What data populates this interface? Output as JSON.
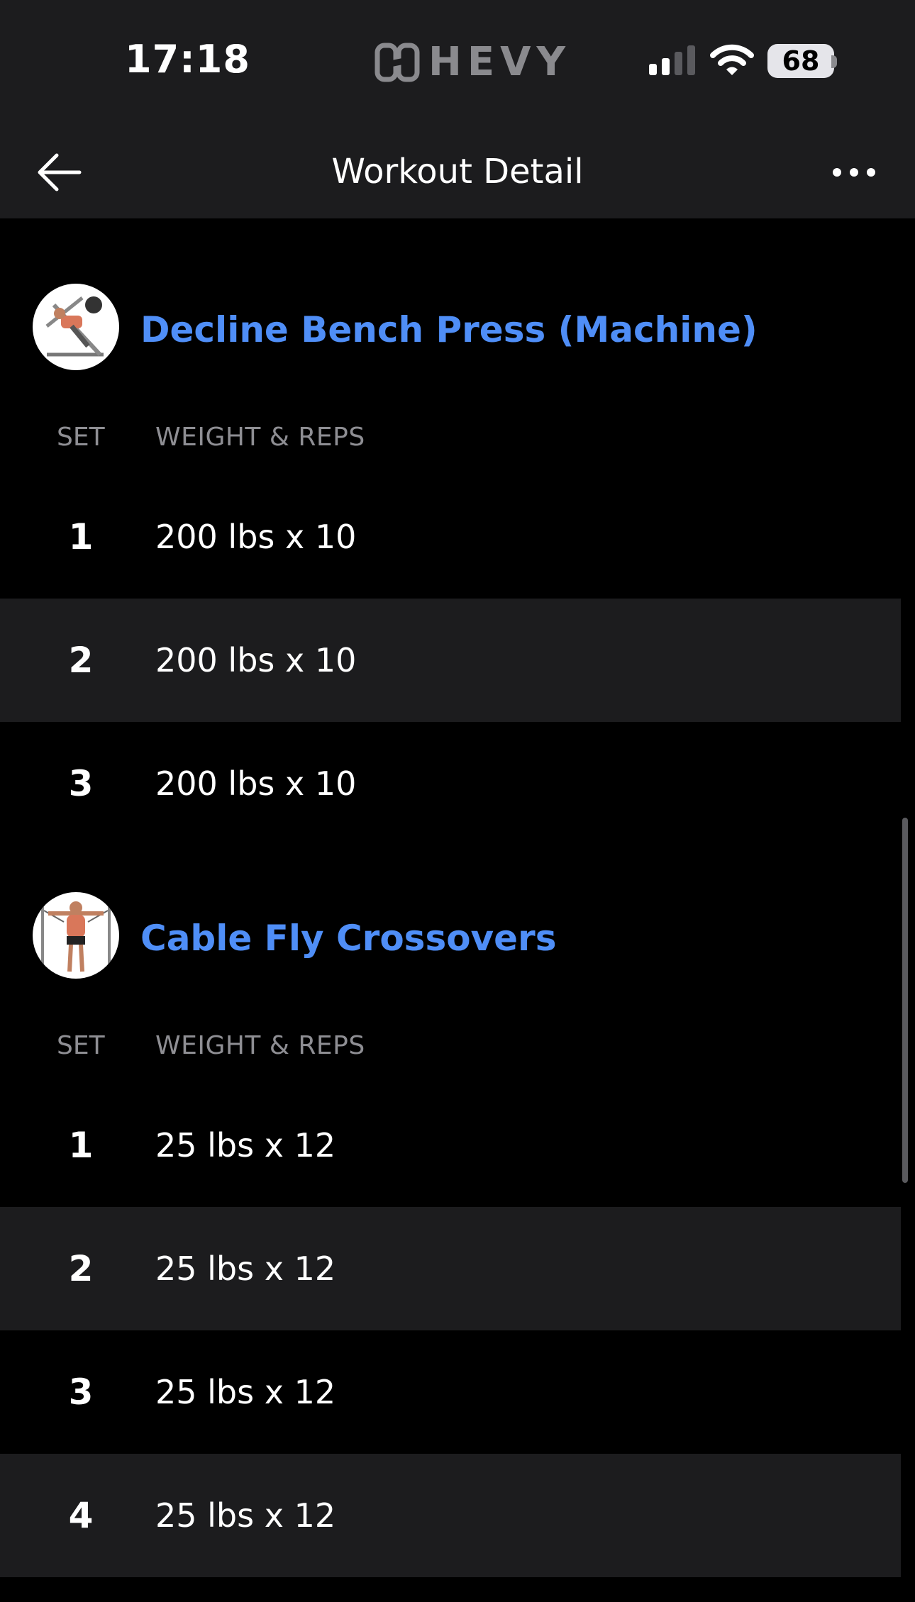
{
  "status_bar": {
    "time": "17:18",
    "brand": "HEVY",
    "battery": "68"
  },
  "nav": {
    "title": "Workout Detail"
  },
  "exercises": [
    {
      "name": "Decline Bench Press (Machine)",
      "col_set": "SET",
      "col_weight_reps": "WEIGHT & REPS",
      "sets": [
        {
          "num": "1",
          "value": "200 lbs x 10"
        },
        {
          "num": "2",
          "value": "200 lbs x 10"
        },
        {
          "num": "3",
          "value": "200 lbs x 10"
        }
      ]
    },
    {
      "name": "Cable Fly Crossovers",
      "col_set": "SET",
      "col_weight_reps": "WEIGHT & REPS",
      "sets": [
        {
          "num": "1",
          "value": "25 lbs x 12"
        },
        {
          "num": "2",
          "value": "25 lbs x 12"
        },
        {
          "num": "3",
          "value": "25 lbs x 12"
        },
        {
          "num": "4",
          "value": "25 lbs x 12"
        }
      ]
    }
  ],
  "colors": {
    "accent": "#4f8ef7",
    "bar": "#1c1c1e",
    "background": "#000000"
  }
}
